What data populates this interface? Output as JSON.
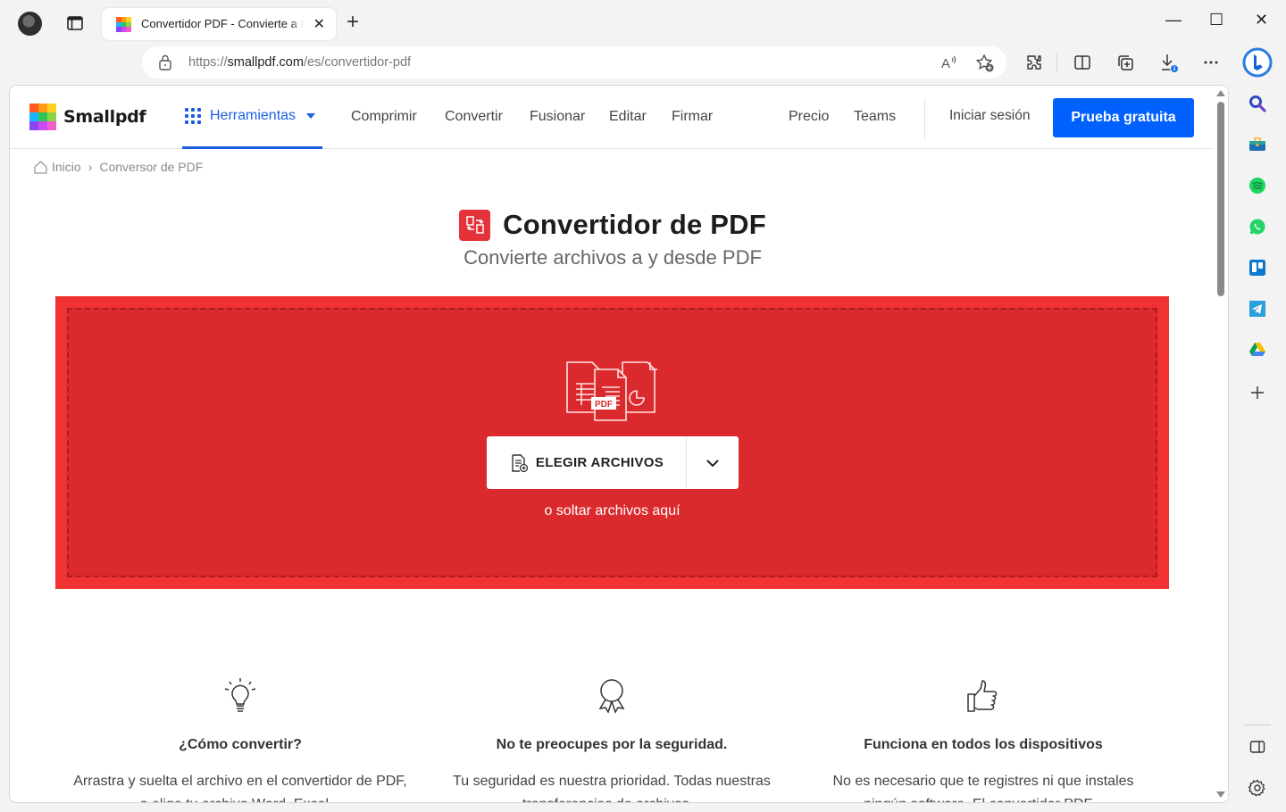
{
  "browser": {
    "tab_title": "Convertidor PDF - Convierte a PDF",
    "url_prefix": "https://",
    "url_host": "smallpdf.com",
    "url_path": "/es/convertidor-pdf",
    "new_tab": "+",
    "tab_close": "✕",
    "minimize": "—",
    "maximize": "☐",
    "close": "✕"
  },
  "site": {
    "logo": "Smallpdf",
    "tools_label": "Herramientas",
    "nav": [
      "Comprimir",
      "Convertir",
      "Fusionar",
      "Editar",
      "Firmar"
    ],
    "nav_right": [
      "Precio",
      "Teams"
    ],
    "login": "Iniciar sesión",
    "cta": "Prueba gratuita",
    "brand_color": "#0061fe",
    "accent_red": "#db2a2d"
  },
  "breadcrumb": {
    "home": "Inicio",
    "separator": "›",
    "current": "Conversor de PDF"
  },
  "hero": {
    "title": "Convertidor de PDF",
    "subtitle": "Convierte archivos a y desde PDF",
    "choose_button": "ELEGIR ARCHIVOS",
    "drop_hint": "o soltar archivos aquí",
    "art_label": "PDF"
  },
  "features": [
    {
      "icon": "lightbulb-icon",
      "title": "¿Cómo convertir?",
      "text": "Arrastra y suelta el archivo en el convertidor de PDF, o elige tu archivo Word, Excel..."
    },
    {
      "icon": "award-ribbon-icon",
      "title": "No te preocupes por la seguridad.",
      "text": "Tu seguridad es nuestra prioridad. Todas nuestras transferencias de archivos..."
    },
    {
      "icon": "thumbs-up-icon",
      "title": "Funciona en todos los dispositivos",
      "text": "No es necesario que te registres ni que instales ningún software. El convertidor PDF..."
    }
  ],
  "sidebar": [
    "search",
    "tools",
    "spotify",
    "whatsapp",
    "trello",
    "telegram",
    "google-drive",
    "add"
  ]
}
